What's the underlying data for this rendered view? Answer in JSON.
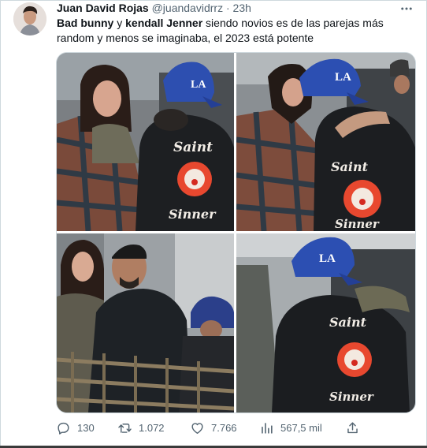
{
  "tweet": {
    "author_name": "Juan David Rojas",
    "author_handle": "@juandavidrrz",
    "separator": "·",
    "time": "23h",
    "text_parts": {
      "p1": "Bad bunny",
      "p2": " y ",
      "p3": "kendall Jenner",
      "p4": " siendo novios es de las parejas más random y menos se imaginaba, el 2023 está potente"
    }
  },
  "media": {
    "jacket_text_1": "Saint",
    "jacket_text_2": "Sinner",
    "cap_logo": "LA"
  },
  "actions": {
    "replies": "130",
    "retweets": "1.072",
    "likes": "7.766",
    "views": "567,5 mil"
  },
  "icons": [
    "more-icon",
    "reply-icon",
    "retweet-icon",
    "like-icon",
    "views-icon",
    "share-icon"
  ],
  "colors": {
    "text": "#0f1419",
    "secondary": "#536471",
    "border": "#cfd9de"
  }
}
